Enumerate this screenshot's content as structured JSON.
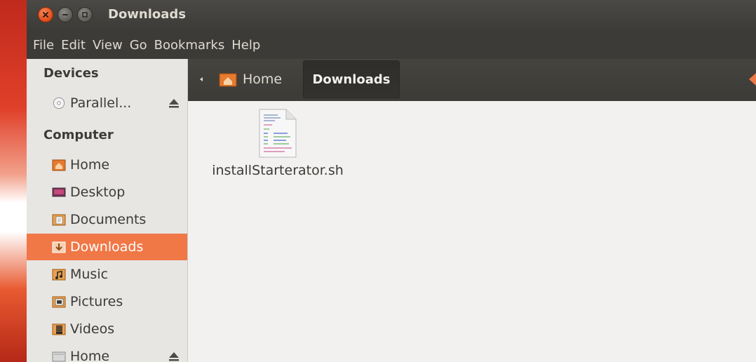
{
  "window": {
    "title": "Downloads"
  },
  "menubar": {
    "items": [
      "File",
      "Edit",
      "View",
      "Go",
      "Bookmarks",
      "Help"
    ]
  },
  "sidebar": {
    "devices_header": "Devices",
    "devices": [
      {
        "label": "Parallel...",
        "icon": "cd-icon",
        "ejectable": true
      }
    ],
    "computer_header": "Computer",
    "computer": [
      {
        "label": "Home",
        "icon": "home-folder-icon"
      },
      {
        "label": "Desktop",
        "icon": "desktop-icon"
      },
      {
        "label": "Documents",
        "icon": "documents-folder-icon"
      },
      {
        "label": "Downloads",
        "icon": "downloads-folder-icon",
        "active": true
      },
      {
        "label": "Music",
        "icon": "music-folder-icon"
      },
      {
        "label": "Pictures",
        "icon": "pictures-folder-icon"
      },
      {
        "label": "Videos",
        "icon": "videos-folder-icon"
      },
      {
        "label": "Home",
        "icon": "drive-icon",
        "ejectable": true
      }
    ]
  },
  "toolbar": {
    "breadcrumbs": [
      "Home",
      "Downloads"
    ]
  },
  "files": [
    {
      "name": "installStarterator.sh",
      "icon": "shell-script-icon"
    }
  ],
  "colors": {
    "accent": "#f07746",
    "titlebar": "#3c3b37",
    "close_button": "#df4a16"
  }
}
